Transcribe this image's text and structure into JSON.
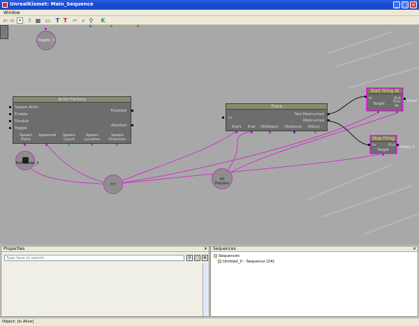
{
  "window": {
    "title": "UnrealKismet: Main_Sequence"
  },
  "menu": {
    "window": "Window"
  },
  "toolbar": {
    "icons": [
      "back-arrow-icon",
      "forward-arrow-icon",
      "dropdown-icon",
      "up-arrow-icon",
      "save-icon",
      "print-icon",
      "text-icon",
      "text-alt-icon",
      "comment-icon",
      "zoom-icon",
      "search-icon",
      "k-icon"
    ]
  },
  "canvas": {
    "toggle_node": "Toggle_0",
    "actor_factory": {
      "title": "Actor Factory",
      "inputs": [
        "Spawn Actor",
        "Enable",
        "Disable",
        "Toggle"
      ],
      "outputs": [
        "Finished",
        "Aborted"
      ],
      "vars": [
        "Spawn Point",
        "Spawned",
        "Spawn Count",
        "Spawn Location",
        "Spawn Direction"
      ]
    },
    "path_node": "PathNode_0",
    "var_unknown": "???",
    "var_all_players": "All Players",
    "trace": {
      "title": "Trace",
      "input": "In",
      "outputs": [
        "Not Obstructed",
        "Obstructed"
      ],
      "vars": [
        "Start",
        "End",
        "HitObject",
        "Distance",
        "HitLoc"
      ]
    },
    "start_firing": {
      "title": "Start Firing At",
      "input": "In",
      "output": "Out",
      "target": "Target",
      "fire_at": "Fire At",
      "extra": "Halar"
    },
    "stop_firing": {
      "title": "Stop Firing",
      "input": "In",
      "output": "Out",
      "target": "Target",
      "delay": "Delay 0"
    }
  },
  "properties": {
    "title": "Properties",
    "search_placeholder": "Type here to search"
  },
  "sequences": {
    "title": "Sequences",
    "root": "Sequences",
    "item": "Untitled_0 - Sequence [24]"
  },
  "status": {
    "text": "Object: [Is Alive]"
  },
  "colors": {
    "titlebar": "#1a4fd6",
    "canvas": "#a8a8a8",
    "link": "#cc33cc",
    "node_border_active": "#c020c0"
  }
}
